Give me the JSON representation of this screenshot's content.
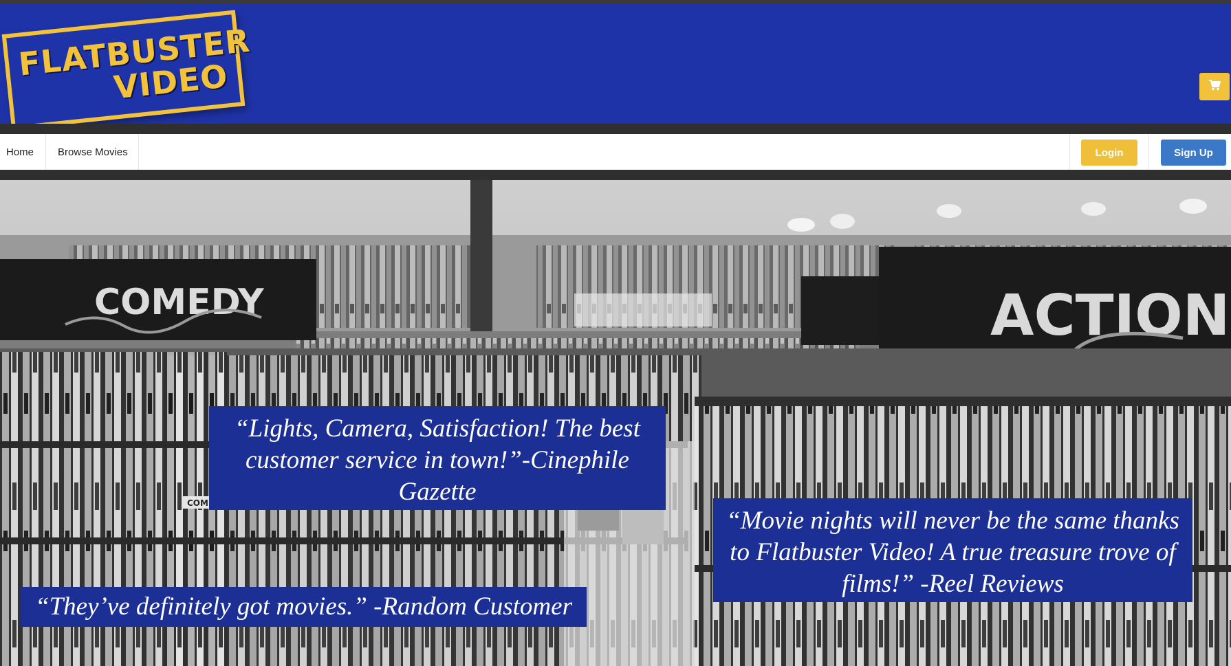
{
  "header": {
    "logo_line1": "FLATBUSTER",
    "logo_line2": "VIDEO",
    "cart_icon": "shopping-cart-icon"
  },
  "nav": {
    "home": "Home",
    "browse": "Browse Movies",
    "login": "Login",
    "signup": "Sign Up"
  },
  "hero": {
    "signs": {
      "comedy": "COMEDY",
      "action": "ACTION",
      "comedy_shelf_tag": "COMEDY >"
    },
    "quotes": [
      "“Lights, Camera, Satisfaction! The best customer service in town!”-Cinephile Gazette",
      "“Movie nights will never be the same thanks to Flatbuster Video! A true treasure trove of films!” -Reel Reviews",
      "“They’ve definitely got movies.” -Random Customer"
    ]
  },
  "colors": {
    "header_blue": "#1f33a8",
    "logo_yellow": "#f2c33a",
    "login_yellow": "#f0bf3a",
    "signup_blue": "#3c78c8",
    "quote_blue": "#1c2f94"
  }
}
